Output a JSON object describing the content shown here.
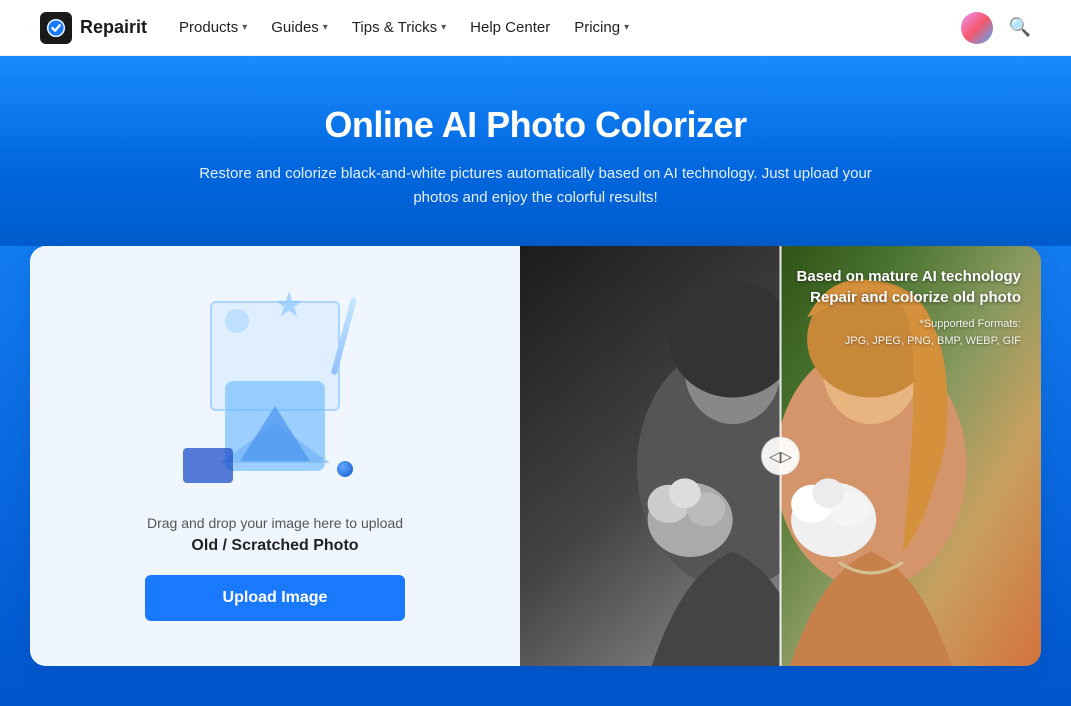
{
  "brand": {
    "name": "Repairit"
  },
  "nav": {
    "items": [
      {
        "label": "Products",
        "has_dropdown": true
      },
      {
        "label": "Guides",
        "has_dropdown": true
      },
      {
        "label": "Tips & Tricks",
        "has_dropdown": true
      },
      {
        "label": "Help Center",
        "has_dropdown": false
      },
      {
        "label": "Pricing",
        "has_dropdown": true
      }
    ],
    "search_label": "Search",
    "avatar_label": "User Avatar"
  },
  "hero": {
    "title": "Online AI Photo Colorizer",
    "subtitle": "Restore and colorize black-and-white pictures automatically based on AI technology. Just upload your photos and enjoy the colorful results!"
  },
  "upload_panel": {
    "drag_text": "Drag and drop your image here to upload",
    "photo_type": "Old / Scratched Photo",
    "button_label": "Upload Image"
  },
  "preview_panel": {
    "title_line1": "Based on mature AI technology",
    "title_line2": "Repair and colorize old photo",
    "support_label": "*Supported Formats:",
    "formats": "JPG, JPEG, PNG, BMP, WEBP, GIF"
  },
  "colors": {
    "primary_blue": "#1a7aff",
    "hero_bg_top": "#1a8bff",
    "hero_bg_bottom": "#0055cc"
  }
}
